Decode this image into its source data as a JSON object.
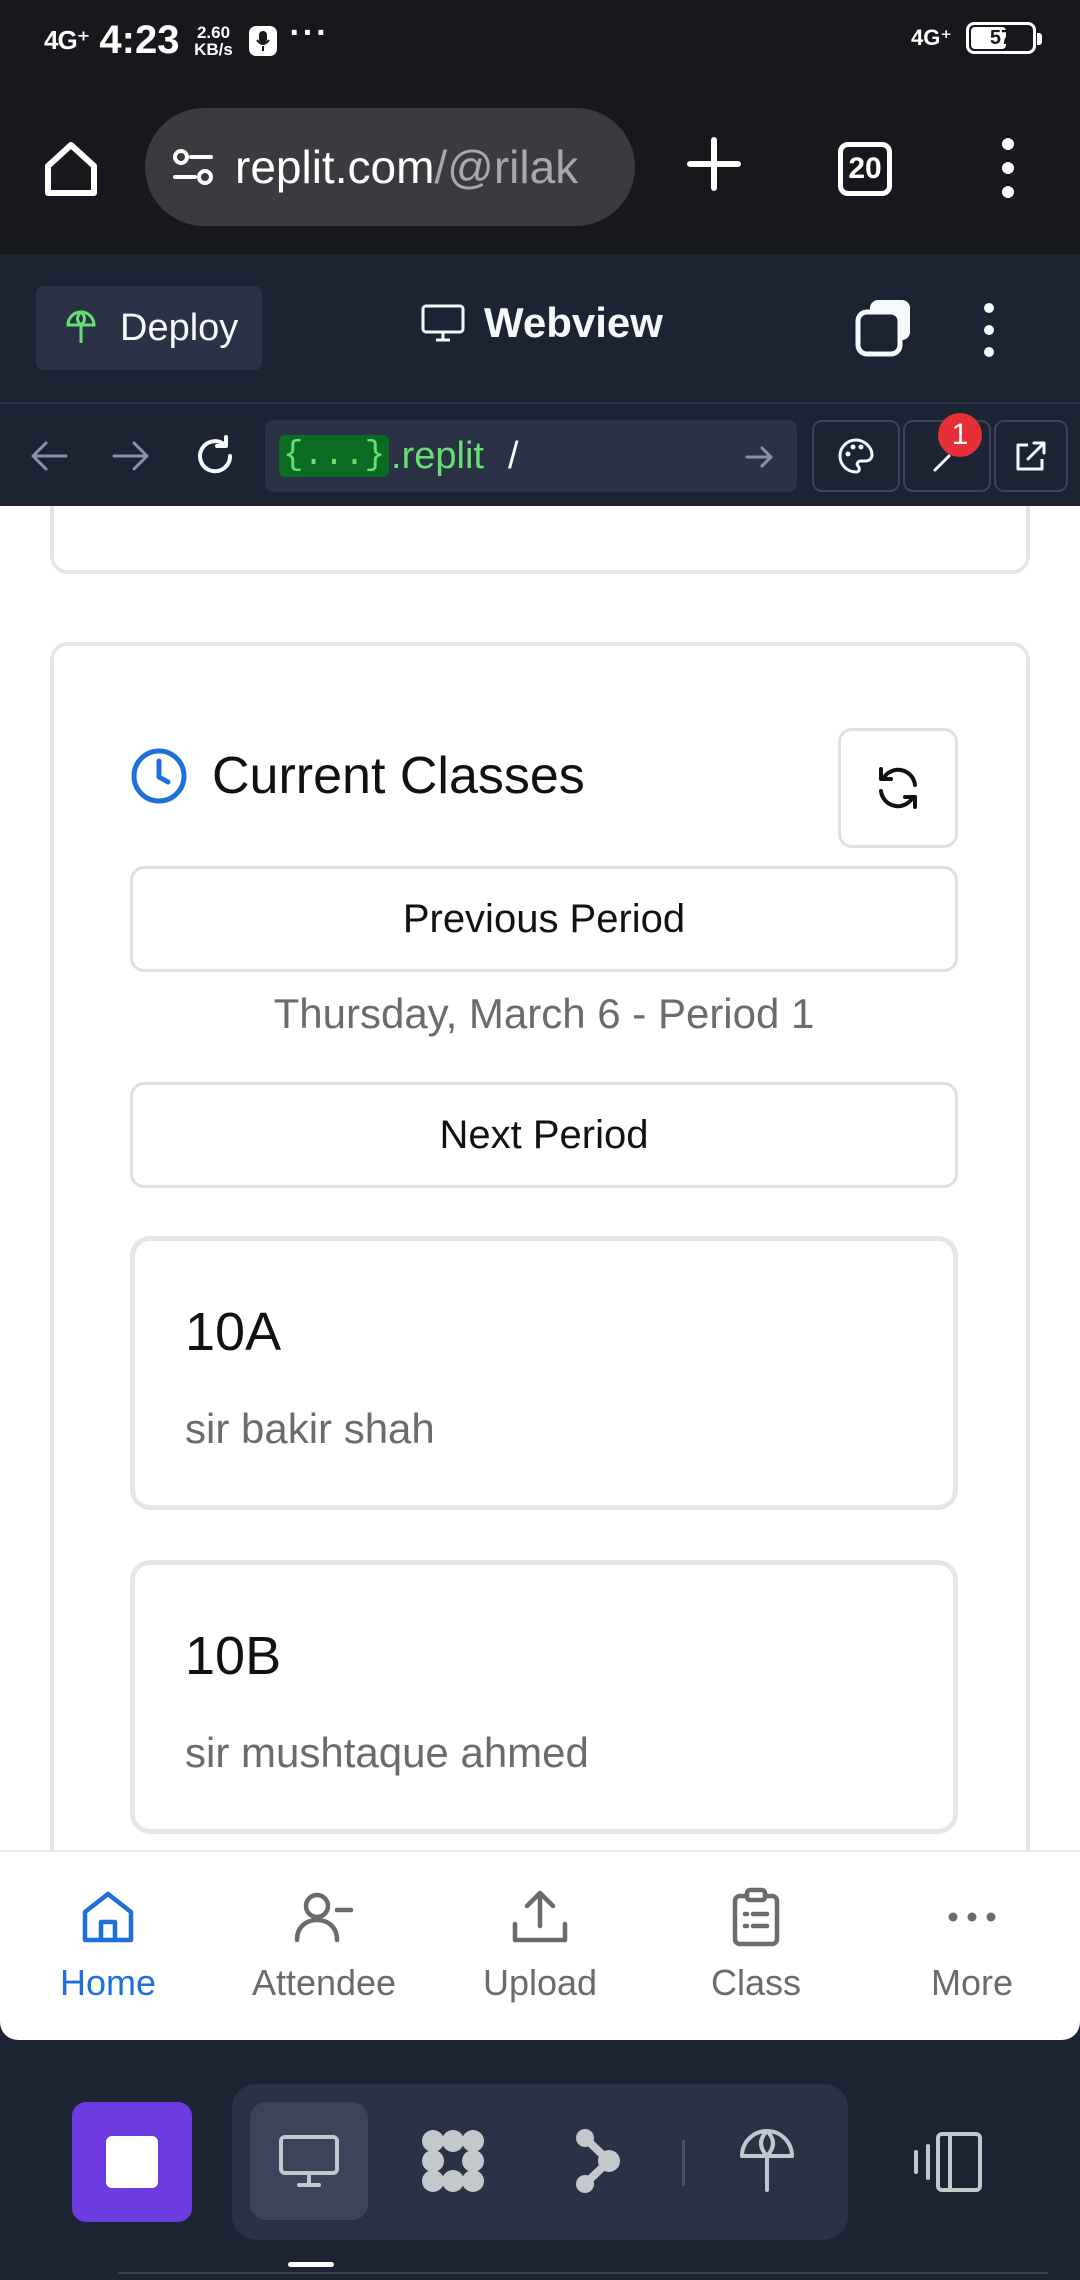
{
  "status_bar": {
    "network_left": "4G⁺",
    "time": "4:23",
    "speed_value": "2.60",
    "speed_unit": "KB/s",
    "more_dots": "···",
    "network_right": "4G⁺",
    "battery": "57"
  },
  "browser": {
    "url_host": "replit.com",
    "url_path": "/@rilak",
    "tab_count": "20"
  },
  "replit_header": {
    "deploy_label": "Deploy",
    "title": "Webview"
  },
  "webview_bar": {
    "url_chip": "{...}",
    "url_domain": ".replit",
    "url_path": "/",
    "badge_count": "1"
  },
  "current_classes": {
    "title": "Current Classes",
    "previous_label": "Previous Period",
    "period_text": "Thursday, March 6 - Period 1",
    "next_label": "Next Period",
    "classes": [
      {
        "name": "10A",
        "teacher": "sir bakir shah"
      },
      {
        "name": "10B",
        "teacher": "sir mushtaque ahmed"
      }
    ]
  },
  "bottom_nav": {
    "items": [
      {
        "label": "Home",
        "icon": "home-icon",
        "active": true
      },
      {
        "label": "Attendee",
        "icon": "user-minus-icon",
        "active": false
      },
      {
        "label": "Upload",
        "icon": "upload-icon",
        "active": false
      },
      {
        "label": "Class",
        "icon": "clipboard-icon",
        "active": false
      },
      {
        "label": "More",
        "icon": "more-horizontal-icon",
        "active": false
      }
    ],
    "active_color": "#1e6fd9"
  },
  "colors": {
    "replit_bg": "#1c2333",
    "replit_accent": "#6d3ce0",
    "url_green": "#65e071",
    "badge_red": "#e52f39"
  }
}
